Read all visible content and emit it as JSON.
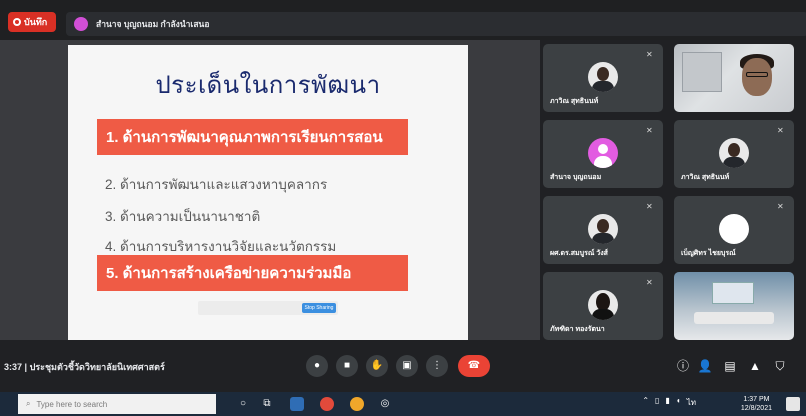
{
  "topbar": {
    "record_label": "บันทึก",
    "presenter_label": "สำนาจ บุญถนอม กำลังนำเสนอ"
  },
  "slide": {
    "title": "ประเด็นในการพัฒนา",
    "items": [
      "1.  ด้านการพัฒนาคุณภาพการเรียนการสอน",
      "2. ด้านการพัฒนาและแสวงหาบุคลากร",
      "3. ด้านความเป็นนานาชาติ",
      "4. ด้านการบริหารงานวิจัยและนวัตกรรม",
      "5.  ด้านการสร้างเครือข่ายความร่วมมือ"
    ],
    "input_button": "Stop Sharing"
  },
  "participants": [
    {
      "name": "ภาวิณ สุทธินนท์"
    },
    {
      "name": ""
    },
    {
      "name": "สำนาจ บุญถนอม"
    },
    {
      "name": "ภาวิณ สุทธินนท์"
    },
    {
      "name": "ผศ.ดร.สมบูรณ์ วังส์"
    },
    {
      "name": "เบ็ญศิทร ไชยบุรณ์"
    },
    {
      "name": "ภัทฑิดา ทองรัตนา"
    },
    {
      "name": ""
    }
  ],
  "bottombar": {
    "time": "3:37",
    "meeting_title": "ประชุมตัวชี้วัดวิทยาลัยนิเทศศาสตร์"
  },
  "taskbar": {
    "search_placeholder": "Type here to search",
    "time": "1:37 PM",
    "date": "12/8/2021"
  },
  "colors": {
    "accent_red": "#ea4335",
    "slide_highlight": "#ef5b45",
    "slide_title": "#1a2a6e"
  }
}
